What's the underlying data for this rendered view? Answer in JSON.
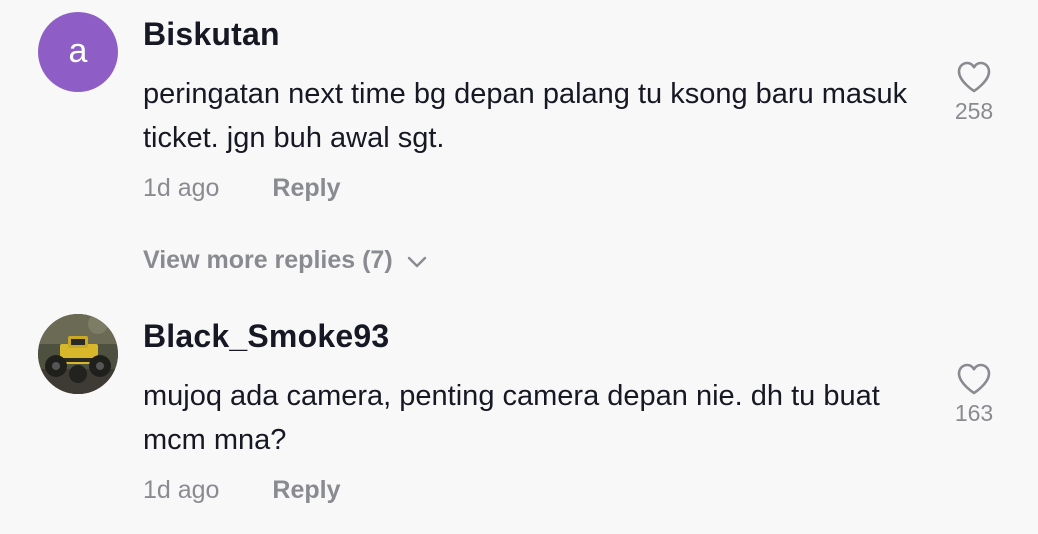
{
  "comments": [
    {
      "avatar_letter": "a",
      "avatar_color": "#8e5ec6",
      "username": "Biskutan",
      "text": "peringatan next time bg depan palang tu ksong baru masuk ticket. jgn buh awal sgt.",
      "time": "1d ago",
      "reply_label": "Reply",
      "likes": "258",
      "like_icon": "heart-outline-icon",
      "view_more_label": "View more replies (7)",
      "view_more_icon": "chevron-down-icon"
    },
    {
      "avatar_icon": "rc-truck-photo",
      "username": "Black_Smoke93",
      "text": "mujoq ada camera, penting camera depan nie. dh tu buat mcm mna?",
      "time": "1d ago",
      "reply_label": "Reply",
      "likes": "163",
      "like_icon": "heart-outline-icon"
    }
  ],
  "colors": {
    "background": "#f8f8f8",
    "primary_text": "#161823",
    "secondary_text": "#8a8b91"
  }
}
